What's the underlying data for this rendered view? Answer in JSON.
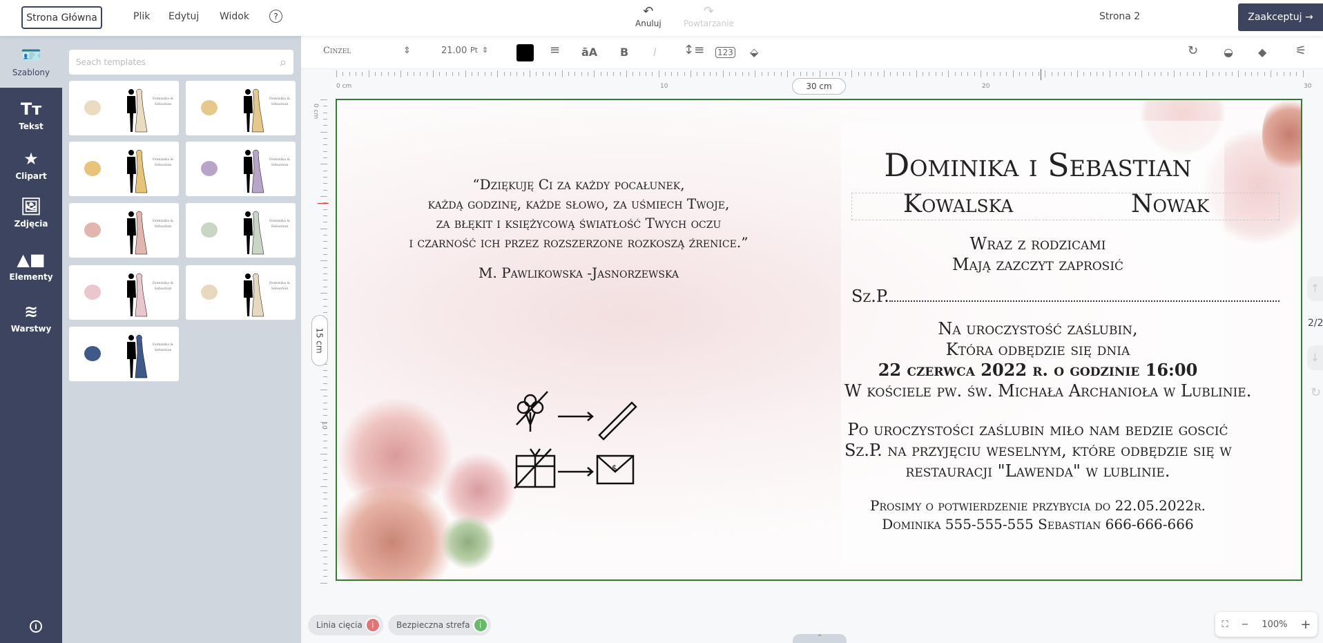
{
  "topbar": {
    "home": "Strona Główna",
    "menu": [
      "Plik",
      "Edytuj",
      "Widok"
    ],
    "help": "?",
    "undo": "Anuluj",
    "redo": "Powtarzanie",
    "page": "Strona 2",
    "accept": "Zaakceptuj →"
  },
  "sidebar": {
    "items": [
      {
        "label": "Szablony",
        "icon": "id-card-icon"
      },
      {
        "label": "Tekst",
        "icon": "text-icon"
      },
      {
        "label": "Clipart",
        "icon": "star-icon"
      },
      {
        "label": "Zdjęcia",
        "icon": "image-icon"
      },
      {
        "label": "Elementy",
        "icon": "shapes-icon"
      },
      {
        "label": "Warstwy",
        "icon": "layers-icon"
      }
    ],
    "info": "i"
  },
  "templates": {
    "search_placeholder": "Seach templates",
    "thumb_text": "Dominika & Sebastian",
    "count": 9,
    "accents": [
      "#e9dcc0",
      "#e6c98a",
      "#e7c477",
      "#b9a4c9",
      "#e2b5ae",
      "#c9d6c3",
      "#eac7cc",
      "#e9d8c0",
      "#3f5a8a"
    ]
  },
  "toolbar": {
    "font": "Cinzel",
    "size": "21.00",
    "unit": "Pt",
    "color": "#000000"
  },
  "ruler": {
    "h_labels": [
      "0 cm",
      "10",
      "20",
      "30"
    ],
    "width_label": "30 cm",
    "v_labels": [
      "0 cm",
      "10"
    ],
    "height_label": "15 cm"
  },
  "invitation": {
    "quote": [
      "“Dziękuję Ci za każdy pocałunek,",
      "każdą godzinę, każde słowo, za uśmiech Twoje,",
      "za błękit i księżycową światłość Twych oczu",
      "i czarność ich przez rozszerzone rozkoszą źrenice.”"
    ],
    "author": "M. Pawlikowska -Jasnorzewska",
    "names": "Dominika i Sebastian",
    "surname1": "Kowalska",
    "surname2": "Nowak",
    "lines1": [
      "Wraz z rodzicami",
      "Mają zazczyt zaprosić"
    ],
    "guest": "Sz.P. ",
    "ceremony": [
      "Na uroczystość zaślubin,",
      "Która odbędzie się dnia"
    ],
    "date": "22 czerwca 2022 r. o godzinie 16:00",
    "church": "W kościele pw. św. Michała Archanioła w Lublinie.",
    "reception": [
      "Po uroczystości zaślubin miło nam bedzie goscić",
      "Sz.P. na przyjęciu weselnym, które odbędzie się w",
      "restauracji \"Lawenda\" w lublinie."
    ],
    "rsvp": [
      "Prosimy o potwierdzenie przybycia do 22.05.2022r.",
      "Dominika 555-555-555 Sebastian 666-666-666"
    ]
  },
  "pager": {
    "label": "2/2"
  },
  "bottom": {
    "cut_line": "Linia cięcia",
    "safe_zone": "Bezpieczna strefa",
    "zoom": "100%",
    "expand": "^"
  }
}
